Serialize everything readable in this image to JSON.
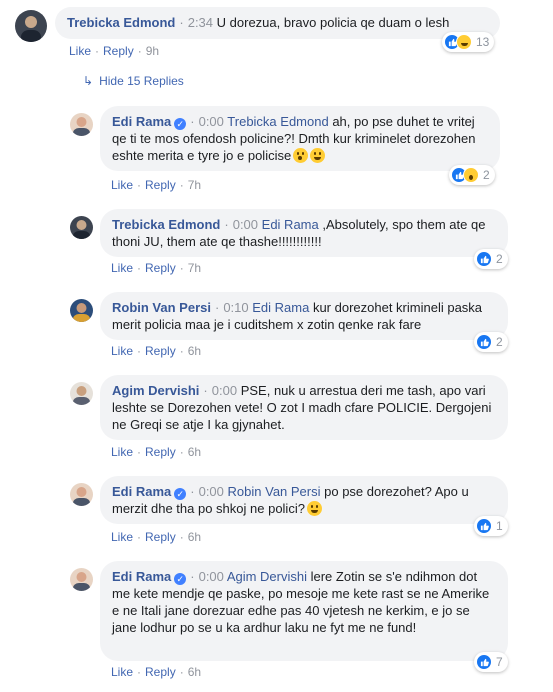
{
  "actions": {
    "like": "Like",
    "reply": "Reply",
    "separator": "·"
  },
  "hide_replies_label": "Hide 15 Replies",
  "comments": [
    {
      "author": "Trebicka Edmond",
      "verified": false,
      "timestamp": "2:34",
      "segments": [
        {
          "type": "text",
          "text": "U dorezua, bravo policia qe duam o lesh"
        }
      ],
      "age": "9h",
      "reactions": [
        "like",
        "haha"
      ],
      "reaction_count": "13"
    },
    {
      "author": "Edi Rama",
      "verified": true,
      "timestamp": "0:00",
      "segments": [
        {
          "type": "mention",
          "text": "Trebicka Edmond"
        },
        {
          "type": "text",
          "text": " ah, po pse duhet te vritej qe ti te mos ofendosh policine?! Dmth kur kriminelet dorezohen eshte merita e tyre jo e policise"
        },
        {
          "type": "emoji",
          "name": "flushed-emoji"
        },
        {
          "type": "emoji",
          "name": "laughing-emoji"
        }
      ],
      "age": "7h",
      "reactions": [
        "like",
        "wow"
      ],
      "reaction_count": "2"
    },
    {
      "author": "Trebicka Edmond",
      "verified": false,
      "timestamp": "0:00",
      "segments": [
        {
          "type": "mention",
          "text": "Edi Rama"
        },
        {
          "type": "text",
          "text": " ,Absolutely, spo them ate qe thoni JU, them ate qe thashe!!!!!!!!!!!!"
        }
      ],
      "age": "7h",
      "reactions": [
        "like"
      ],
      "reaction_count": "2"
    },
    {
      "author": "Robin Van Persi",
      "verified": false,
      "timestamp": "0:10",
      "segments": [
        {
          "type": "mention",
          "text": "Edi Rama"
        },
        {
          "type": "text",
          "text": " kur dorezohet krimineli paska merit policia maa je i cuditshem x zotin qenke rak fare"
        }
      ],
      "age": "6h",
      "reactions": [
        "like"
      ],
      "reaction_count": "2"
    },
    {
      "author": "Agim Dervishi",
      "verified": false,
      "timestamp": "0:00",
      "segments": [
        {
          "type": "text",
          "text": "PSE, nuk u arrestua deri me tash, apo vari leshte se Dorezohen vete! O zot I madh cfare POLICIE. Dergojeni ne Greqi se atje I ka gjynahet."
        }
      ],
      "age": "6h",
      "reactions": [],
      "reaction_count": ""
    },
    {
      "author": "Edi Rama",
      "verified": true,
      "timestamp": "0:00",
      "segments": [
        {
          "type": "mention",
          "text": "Robin Van Persi"
        },
        {
          "type": "text",
          "text": " po pse dorezohet? Apo u merzit dhe tha po shkoj ne polici?"
        },
        {
          "type": "emoji",
          "name": "laughing-emoji"
        }
      ],
      "age": "6h",
      "reactions": [
        "like"
      ],
      "reaction_count": "1"
    },
    {
      "author": "Edi Rama",
      "verified": true,
      "timestamp": "0:00",
      "segments": [
        {
          "type": "mention",
          "text": "Agim Dervishi"
        },
        {
          "type": "text",
          "text": " lere Zotin se s'e ndihmon dot me kete mendje qe paske, po mesoje me kete rast se ne Amerike e ne Itali jane dorezuar edhe pas 40 vjetesh ne kerkim, e jo se jane lodhur po se u ka ardhur laku ne fyt me ne fund!"
        }
      ],
      "age": "6h",
      "reactions": [
        "like"
      ],
      "reaction_count": "7"
    }
  ]
}
